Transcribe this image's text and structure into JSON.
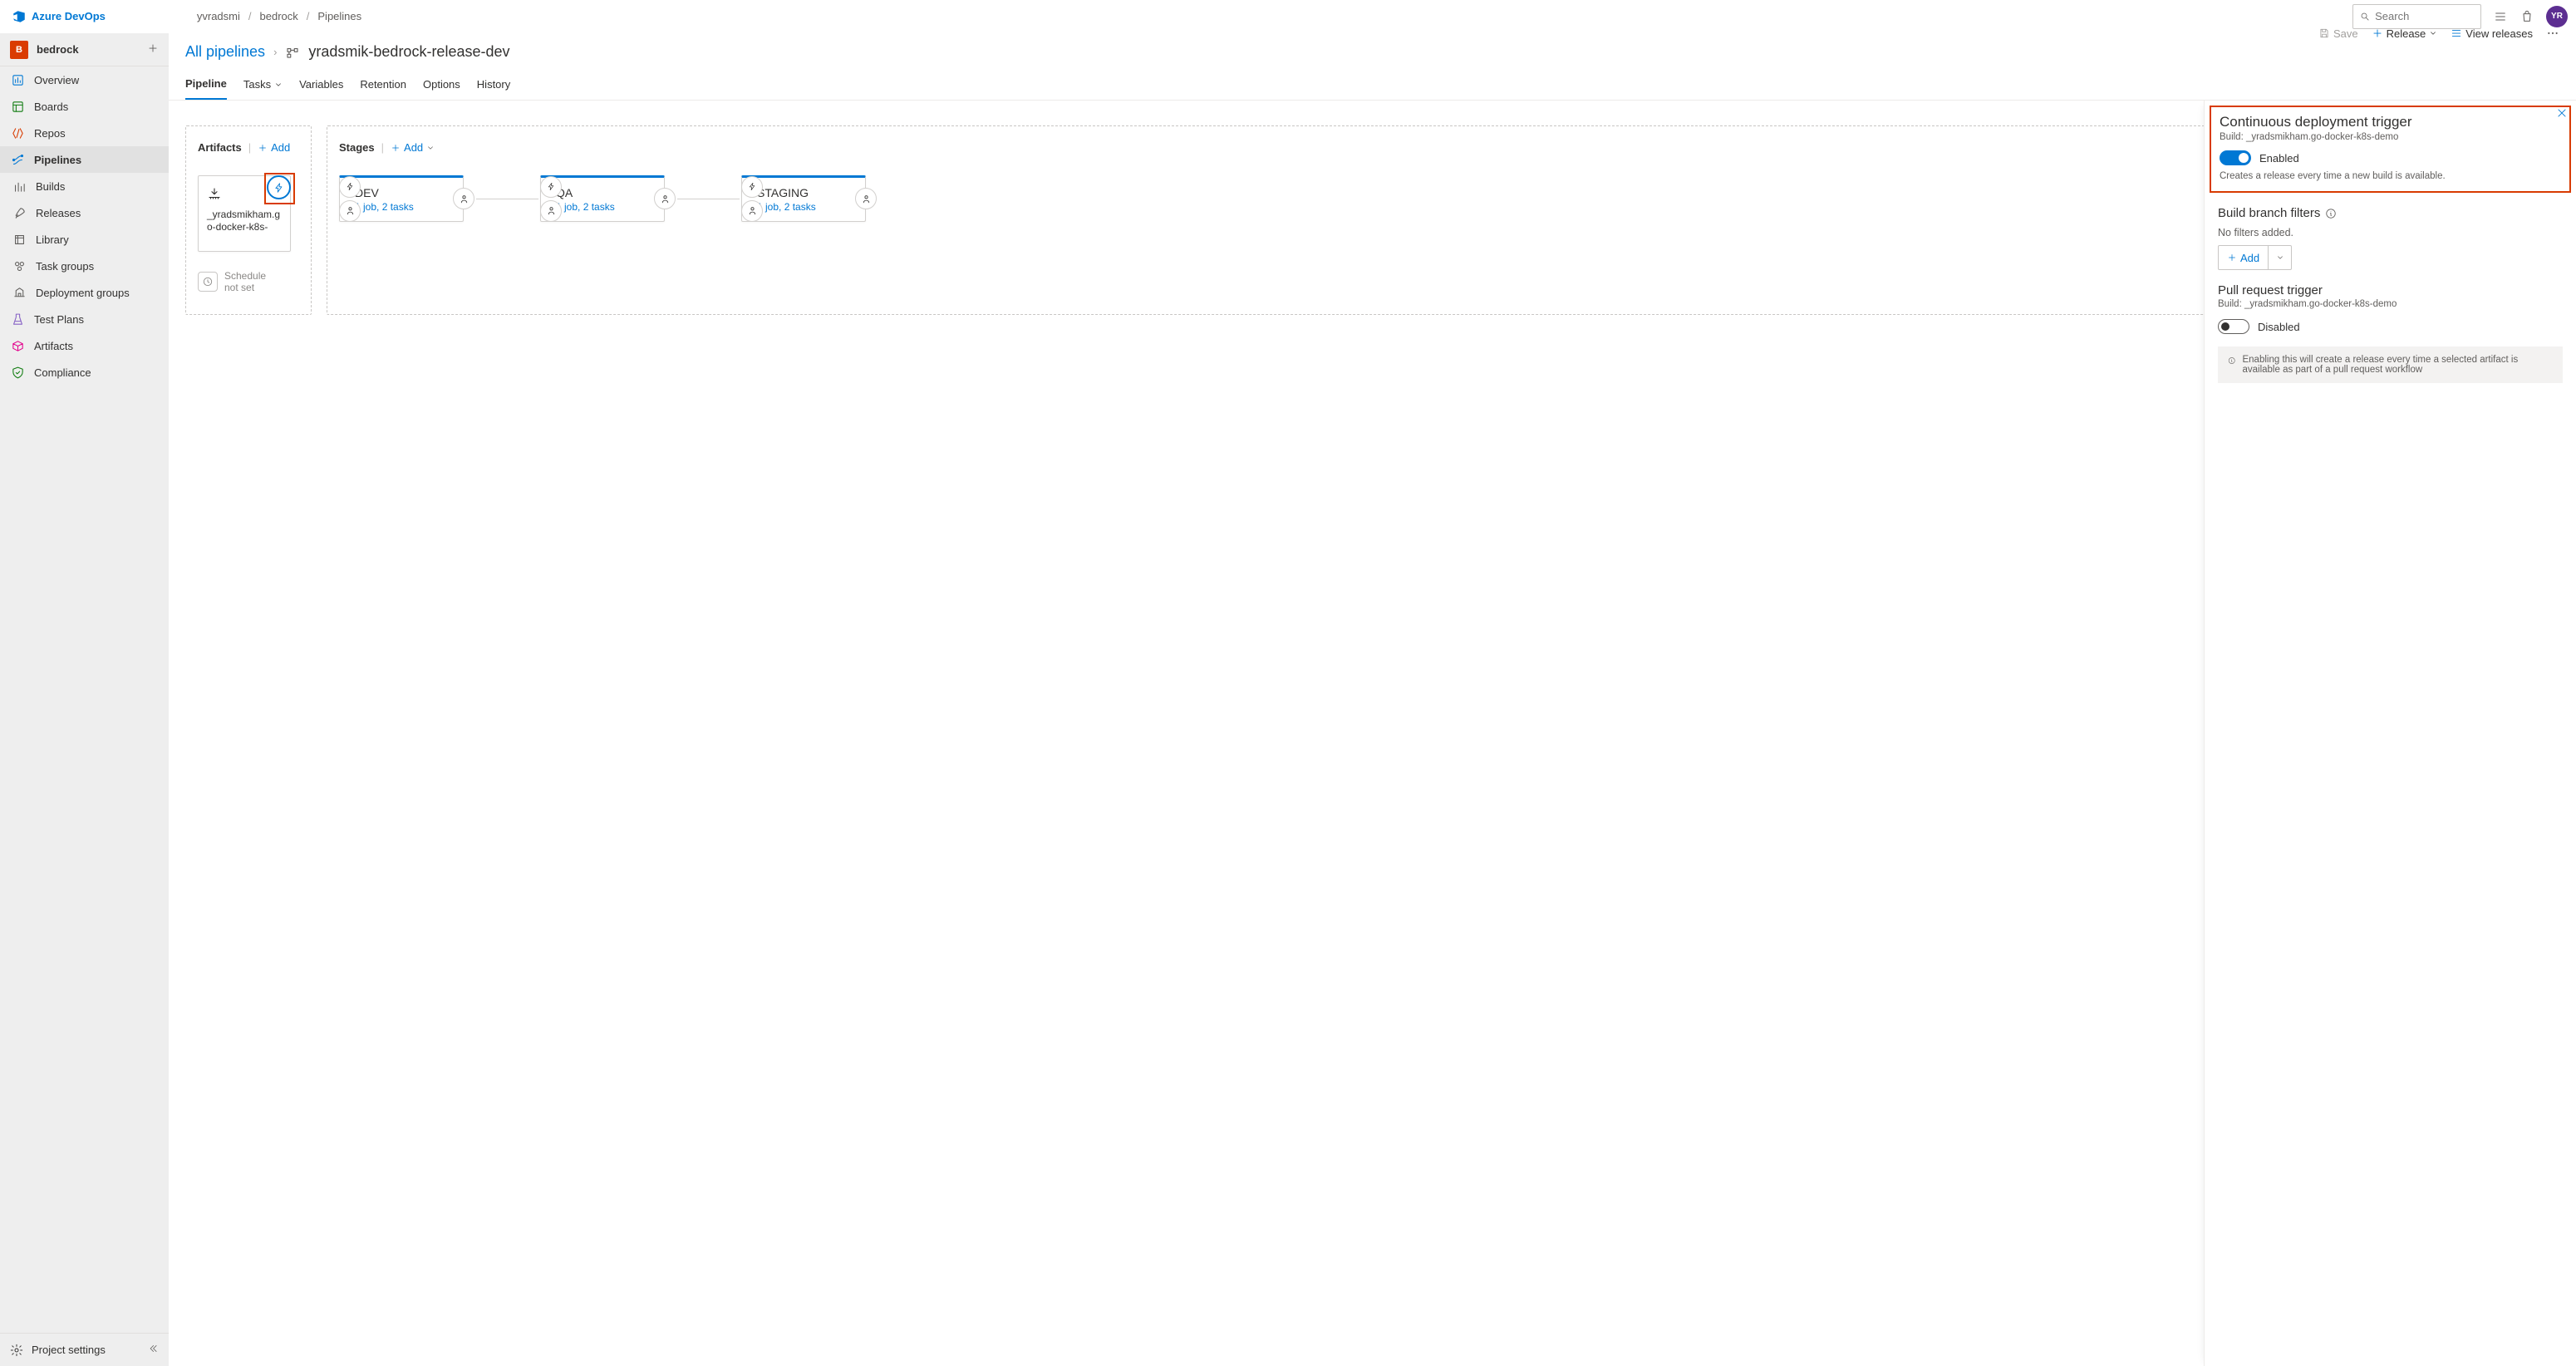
{
  "brand": "Azure DevOps",
  "breadcrumbs": [
    "yvradsmi",
    "bedrock",
    "Pipelines"
  ],
  "search": {
    "placeholder": "Search"
  },
  "avatar_initials": "YR",
  "project": {
    "name": "bedrock",
    "initial": "B"
  },
  "sidebar": {
    "items": [
      {
        "label": "Overview",
        "icon": "overview"
      },
      {
        "label": "Boards",
        "icon": "boards"
      },
      {
        "label": "Repos",
        "icon": "repos"
      },
      {
        "label": "Pipelines",
        "icon": "pipelines",
        "active": true
      },
      {
        "label": "Builds",
        "icon": "builds",
        "sub": true
      },
      {
        "label": "Releases",
        "icon": "releases",
        "sub": true
      },
      {
        "label": "Library",
        "icon": "library",
        "sub": true
      },
      {
        "label": "Task groups",
        "icon": "taskgroups",
        "sub": true
      },
      {
        "label": "Deployment groups",
        "icon": "deployment",
        "sub": true
      },
      {
        "label": "Test Plans",
        "icon": "testplans"
      },
      {
        "label": "Artifacts",
        "icon": "artifacts"
      },
      {
        "label": "Compliance",
        "icon": "compliance"
      }
    ],
    "footer": "Project settings"
  },
  "page": {
    "all_pipelines": "All pipelines",
    "release_name": "yradsmik-bedrock-release-dev"
  },
  "actions": {
    "save": "Save",
    "release": "Release",
    "view_releases": "View releases"
  },
  "tabs": [
    "Pipeline",
    "Tasks",
    "Variables",
    "Retention",
    "Options",
    "History"
  ],
  "artifacts": {
    "heading": "Artifacts",
    "add": "Add",
    "card_label": "_yradsmikham.go-docker-k8s-",
    "schedule": "Schedule\nnot set"
  },
  "stages": {
    "heading": "Stages",
    "add": "Add",
    "list": [
      {
        "name": "DEV",
        "meta": "1 job, 2 tasks"
      },
      {
        "name": "QA",
        "meta": "1 job, 2 tasks"
      },
      {
        "name": "STAGING",
        "meta": "1 job, 2 tasks"
      }
    ]
  },
  "panel": {
    "cd_title": "Continuous deployment trigger",
    "cd_sub": "Build: _yradsmikham.go-docker-k8s-demo",
    "cd_enabled": "Enabled",
    "cd_help": "Creates a release every time a new build is available.",
    "branch_title": "Build branch filters",
    "branch_none": "No filters added.",
    "branch_add": "Add",
    "pr_title": "Pull request trigger",
    "pr_sub": "Build: _yradsmikham.go-docker-k8s-demo",
    "pr_disabled": "Disabled",
    "pr_info": "Enabling this will create a release every time a selected artifact is available as part of a pull request workflow"
  }
}
